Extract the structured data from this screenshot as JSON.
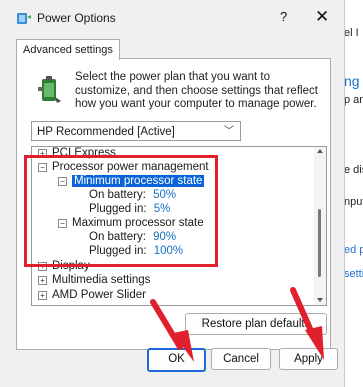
{
  "window": {
    "title": "Power Options",
    "help_label": "?",
    "close_label": "✕"
  },
  "tab": {
    "label": "Advanced settings"
  },
  "intro": {
    "text": "Select the power plan that you want to customize, and then choose settings that reflect how you want your computer to manage power."
  },
  "plan_select": {
    "value": "HP Recommended [Active]"
  },
  "tree": {
    "items": [
      {
        "label": "PCI Express"
      },
      {
        "label": "Processor power management"
      },
      {
        "label": "Minimum processor state"
      },
      {
        "label": "On battery:",
        "value": "50%"
      },
      {
        "label": "Plugged in:",
        "value": "5%"
      },
      {
        "label": "Maximum processor state"
      },
      {
        "label": "On battery:",
        "value": "90%"
      },
      {
        "label": "Plugged in:",
        "value": "100%"
      },
      {
        "label": "Display"
      },
      {
        "label": "Multimedia settings"
      },
      {
        "label": "AMD Power Slider"
      }
    ]
  },
  "buttons": {
    "restore": "Restore plan defaults",
    "ok": "OK",
    "cancel": "Cancel",
    "apply": "Apply"
  },
  "background": {
    "fragments": [
      "el I",
      "ng",
      "p an",
      "e dis",
      "nput",
      "ed p",
      "setti"
    ]
  },
  "colors": {
    "highlight": "#e0202c",
    "selection": "#0a64d8",
    "value_link": "#1a6fc4"
  }
}
